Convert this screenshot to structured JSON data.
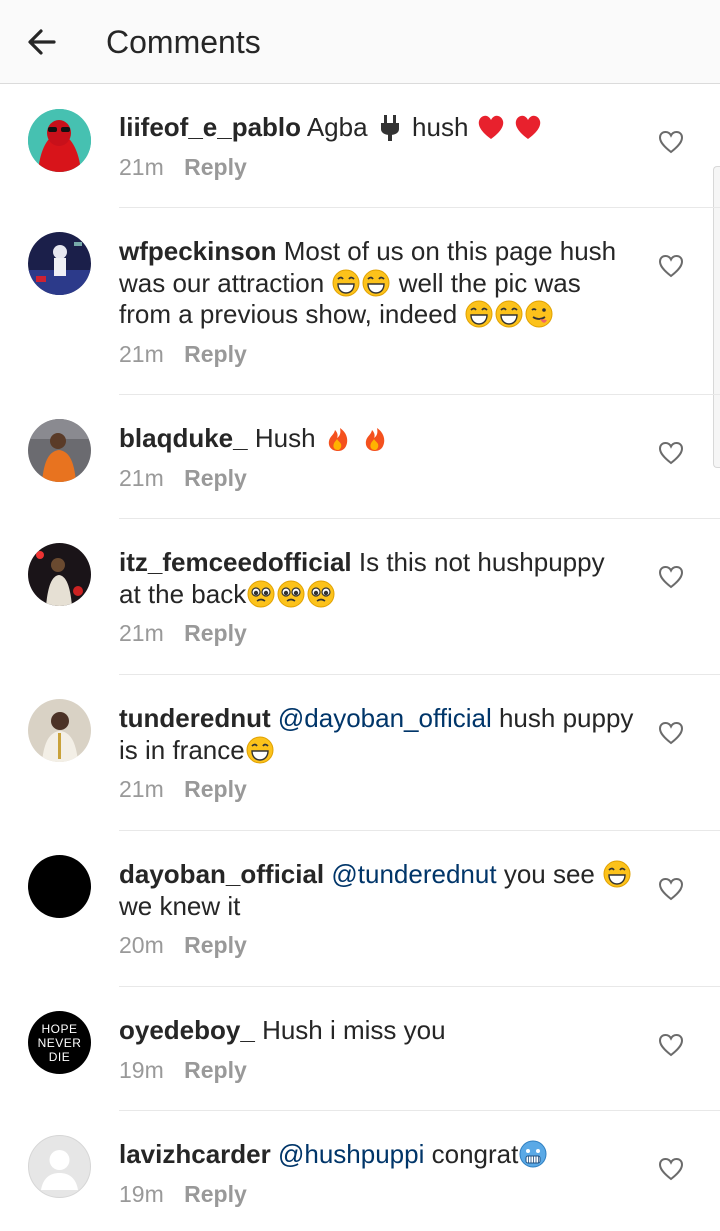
{
  "header": {
    "title": "Comments",
    "back_icon": "arrow-left-icon"
  },
  "colors": {
    "header_bg": "#fafafa",
    "text": "#262626",
    "muted": "#999999",
    "mention": "#003569",
    "divider": "#e8e8e8"
  },
  "comments": [
    {
      "username": "liifeof_e_pablo",
      "text1": "Agba",
      "text2": "hush",
      "time": "21m",
      "reply": "Reply",
      "emojis": [
        "plug-emoji",
        "red-heart-emoji",
        "red-heart-emoji"
      ]
    },
    {
      "username": "wfpeckinson",
      "line1": "Most of us on this page hush",
      "line2": "was our attraction",
      "line2b": "well the pic was",
      "line3": "from a previous show,  indeed",
      "time": "21m",
      "reply": "Reply",
      "emojis": [
        "grinning-sweat-emoji",
        "grinning-sweat-emoji",
        "grinning-sweat-emoji",
        "grinning-sweat-emoji",
        "tongue-out-emoji"
      ]
    },
    {
      "username": "blaqduke_",
      "text": "Hush",
      "time": "21m",
      "reply": "Reply",
      "emojis": [
        "fire-emoji",
        "fire-emoji"
      ]
    },
    {
      "username": "itz_femceedofficial",
      "line1": "Is this not hushpuppy",
      "line2": "at the back",
      "time": "21m",
      "reply": "Reply",
      "emojis": [
        "pleading-face-emoji",
        "pleading-face-emoji",
        "pleading-face-emoji"
      ]
    },
    {
      "username": "tunderednut",
      "mention": "@dayoban_official",
      "line1": "hush puppy",
      "line2": "is in france",
      "time": "21m",
      "reply": "Reply",
      "emojis": [
        "grinning-sweat-emoji"
      ]
    },
    {
      "username": "dayoban_official",
      "mention": "@tunderednut",
      "line1": "you see",
      "line2": "we knew it",
      "time": "20m",
      "reply": "Reply",
      "emojis": [
        "grinning-sweat-emoji"
      ]
    },
    {
      "username": "oyedeboy_",
      "text": "Hush i miss you",
      "time": "19m",
      "reply": "Reply",
      "avatar_text": [
        "HOPE",
        "NEVER",
        "DIE"
      ]
    },
    {
      "username": "lavizhcarder",
      "mention": "@hushpuppi",
      "text": "congrat",
      "time": "19m",
      "reply": "Reply",
      "emojis": [
        "cold-face-emoji"
      ]
    }
  ]
}
